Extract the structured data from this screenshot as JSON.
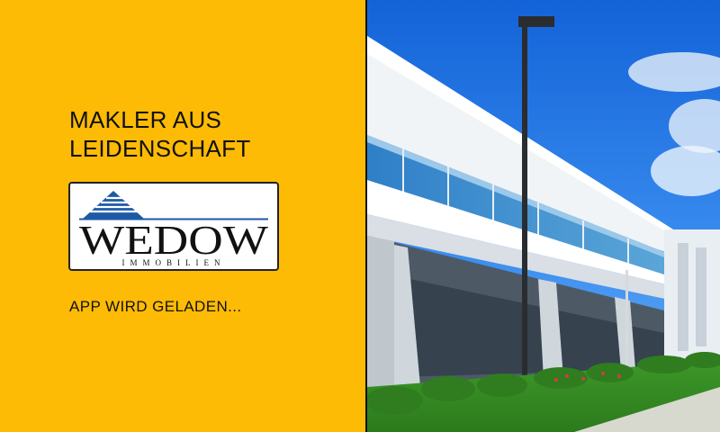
{
  "splash": {
    "tagline_line1": "MAKLER AUS",
    "tagline_line2": "LEIDENSCHAFT",
    "loading_text": "APP WIRD GELADEN...",
    "background_color": "#fdbb06"
  },
  "logo": {
    "brand": "WEDOW",
    "subtitle": "IMMOBILIEN",
    "accent_color": "#1d5aa6"
  },
  "photo": {
    "content": "modern office building"
  }
}
